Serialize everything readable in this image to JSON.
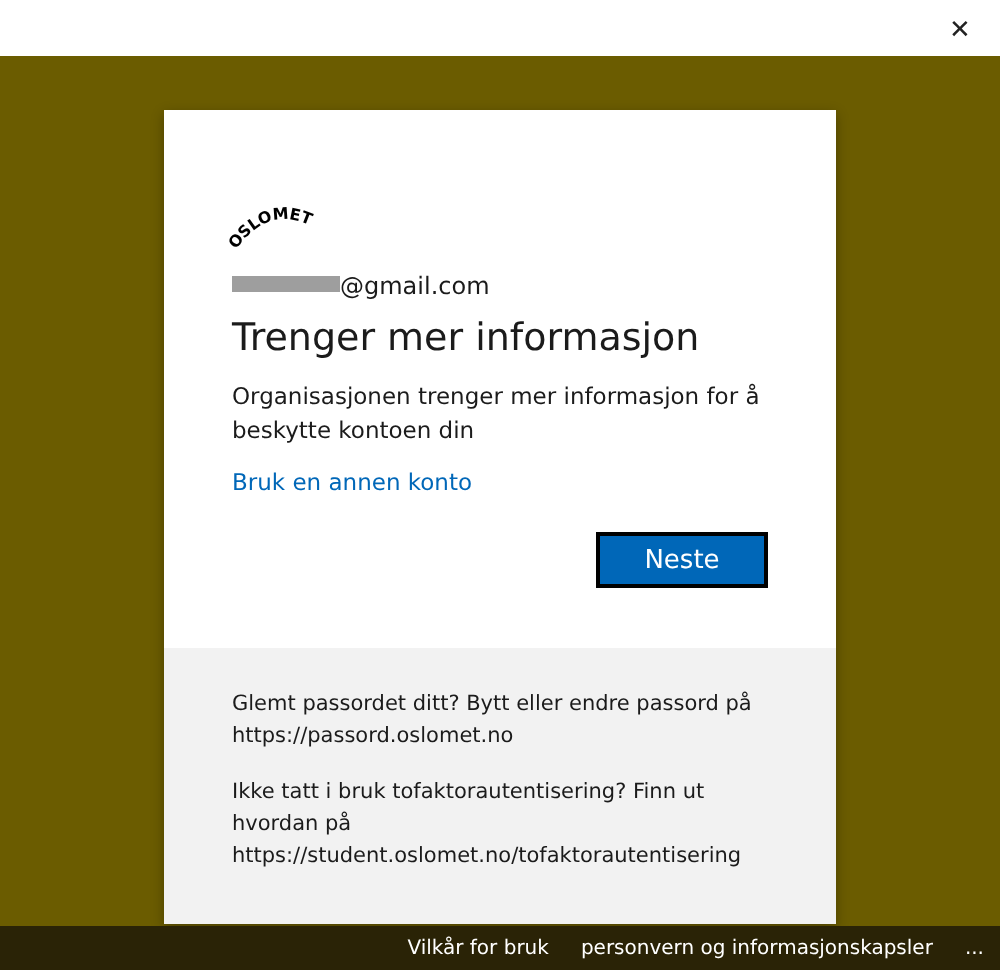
{
  "window": {
    "close": "✕"
  },
  "card": {
    "logo": "OSLOMET",
    "email": "@gmail.com",
    "title": "Trenger mer informasjon",
    "description": "Organisasjonen trenger mer informasjon for å beskytte kontoen din",
    "link": "Bruk en annen konto",
    "button": "Neste"
  },
  "info": [
    "Glemt passordet ditt? Bytt eller endre passord på https://passord.oslomet.no",
    "Ikke tatt i bruk tofaktorautentisering? Finn ut hvordan på https://student.oslomet.no/tofaktorautentisering"
  ],
  "footer": {
    "links": [
      "Vilkår for bruk",
      "personvern og informasjonskapsler"
    ],
    "more": "..."
  }
}
